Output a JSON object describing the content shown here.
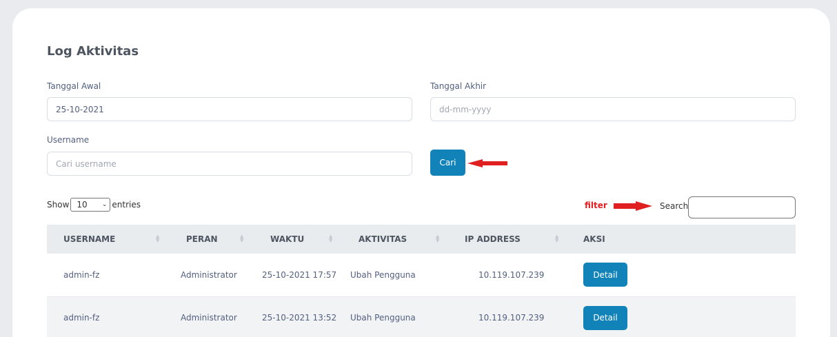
{
  "page": {
    "title": "Log Aktivitas"
  },
  "form": {
    "start_date_label": "Tanggal Awal",
    "start_date_value": "25-10-2021",
    "end_date_label": "Tanggal Akhir",
    "end_date_placeholder": "dd-mm-yyyy",
    "username_label": "Username",
    "username_placeholder": "Cari username",
    "search_button": "Cari"
  },
  "table_controls": {
    "show_label": "Show",
    "entries_value": "10",
    "entries_label": "entries",
    "filter_annotation": "filter",
    "search_label": "Search:"
  },
  "table": {
    "headers": [
      "USERNAME",
      "PERAN",
      "WAKTU",
      "AKTIVITAS",
      "IP ADDRESS",
      "AKSI"
    ],
    "rows": [
      {
        "username": "admin-fz",
        "role": "Administrator",
        "time": "25-10-2021 17:57",
        "activity": "Ubah Pengguna",
        "ip": "10.119.107.239",
        "action": "Detail"
      },
      {
        "username": "admin-fz",
        "role": "Administrator",
        "time": "25-10-2021 13:52",
        "activity": "Ubah Pengguna",
        "ip": "10.119.107.239",
        "action": "Detail"
      }
    ]
  },
  "colors": {
    "primary": "#1283b8",
    "annotation": "#e02020",
    "header_bg": "#e9ecef"
  },
  "icons": {
    "sort": "sort-arrows-icon",
    "dropdown": "chevron-down-icon",
    "annotation": "red-arrow-icon"
  }
}
